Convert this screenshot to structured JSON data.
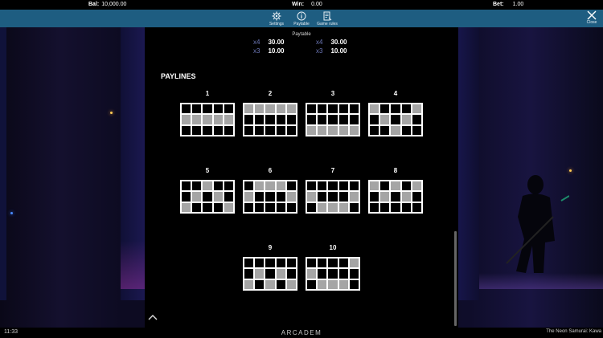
{
  "topbar": {
    "bal_label": "Bal:",
    "bal_value": "10,000.00",
    "win_label": "Win:",
    "win_value": "0.00",
    "bet_label": "Bet:",
    "bet_value": "1.00"
  },
  "menu": {
    "settings": "Settings",
    "paytable": "Paytable",
    "game_rules": "Game rules",
    "close": "Close"
  },
  "panel": {
    "tab_label": "Paytable",
    "pay_rows": [
      {
        "mult": "x4",
        "value": "30.00"
      },
      {
        "mult": "x4",
        "value": "30.00"
      },
      {
        "mult": "x3",
        "value": "10.00"
      },
      {
        "mult": "x3",
        "value": "10.00"
      }
    ],
    "paylines_title": "PAYLINES",
    "paylines": [
      {
        "label": "1",
        "cells": [
          0,
          0,
          0,
          0,
          0,
          1,
          1,
          1,
          1,
          1,
          0,
          0,
          0,
          0,
          0
        ]
      },
      {
        "label": "2",
        "cells": [
          1,
          1,
          1,
          1,
          1,
          0,
          0,
          0,
          0,
          0,
          0,
          0,
          0,
          0,
          0
        ]
      },
      {
        "label": "3",
        "cells": [
          0,
          0,
          0,
          0,
          0,
          0,
          0,
          0,
          0,
          0,
          1,
          1,
          1,
          1,
          1
        ]
      },
      {
        "label": "4",
        "cells": [
          1,
          0,
          0,
          0,
          1,
          0,
          1,
          0,
          1,
          0,
          0,
          0,
          1,
          0,
          0
        ]
      },
      {
        "label": "5",
        "cells": [
          0,
          0,
          1,
          0,
          0,
          0,
          1,
          0,
          1,
          0,
          1,
          0,
          0,
          0,
          1
        ]
      },
      {
        "label": "6",
        "cells": [
          0,
          1,
          1,
          1,
          0,
          1,
          0,
          0,
          0,
          1,
          0,
          0,
          0,
          0,
          0
        ]
      },
      {
        "label": "7",
        "cells": [
          0,
          0,
          0,
          0,
          0,
          1,
          0,
          0,
          0,
          1,
          0,
          1,
          1,
          1,
          0
        ]
      },
      {
        "label": "8",
        "cells": [
          1,
          0,
          1,
          0,
          1,
          0,
          1,
          0,
          1,
          0,
          0,
          0,
          0,
          0,
          0
        ]
      },
      {
        "label": "9",
        "cells": [
          0,
          0,
          0,
          0,
          0,
          0,
          1,
          0,
          1,
          0,
          1,
          0,
          1,
          0,
          1
        ]
      },
      {
        "label": "10",
        "cells": [
          0,
          0,
          0,
          0,
          1,
          1,
          0,
          0,
          0,
          0,
          0,
          1,
          1,
          1,
          0
        ]
      }
    ]
  },
  "bottombar": {
    "time": "11:33",
    "brand": "ARCADEM",
    "game_title": "The Neon Samurai: Kawa"
  },
  "colors": {
    "menubar": "#1e5d81",
    "payline_on": "#a5a5a5",
    "multiplier": "#6d78b8"
  }
}
